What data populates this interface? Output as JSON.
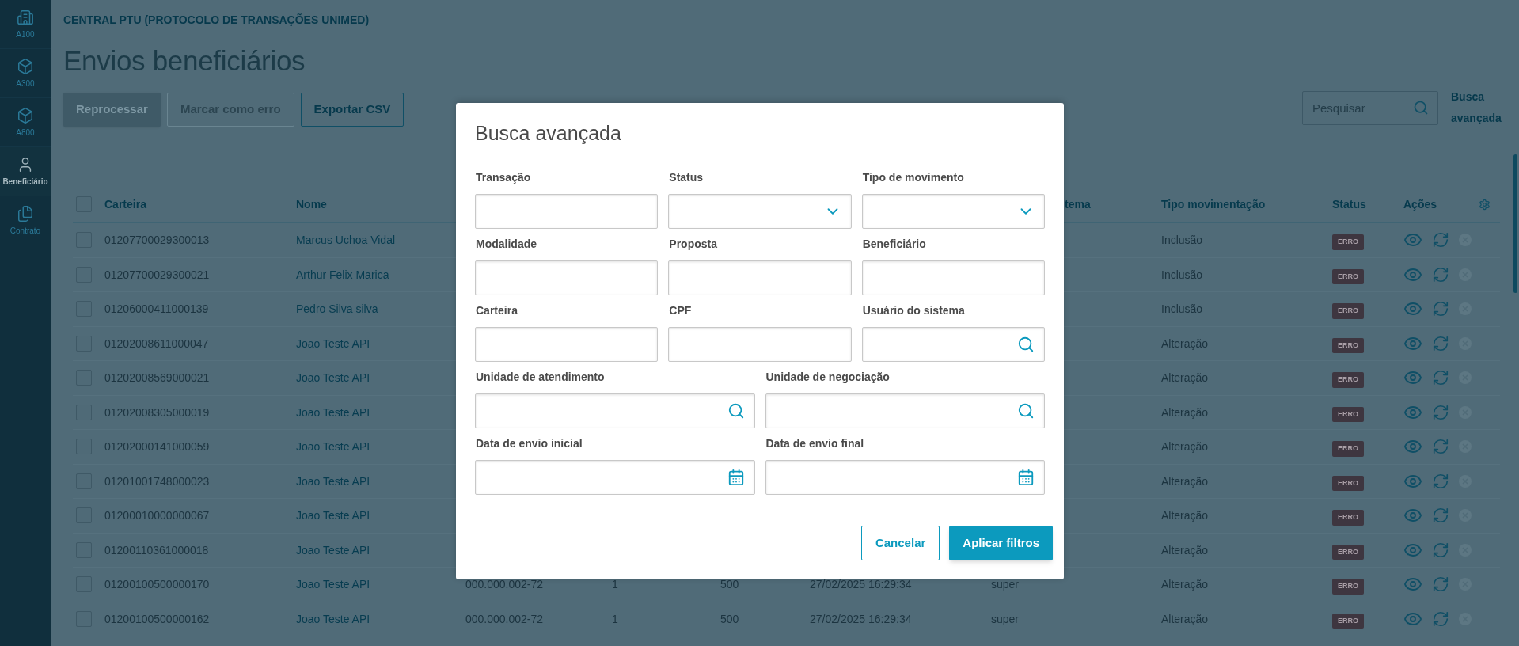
{
  "sidebar": {
    "items": [
      {
        "label": "A100",
        "selected": false
      },
      {
        "label": "A300",
        "selected": false
      },
      {
        "label": "A800",
        "selected": false
      },
      {
        "label": "Beneficiário",
        "selected": true
      },
      {
        "label": "Contrato",
        "selected": false
      }
    ]
  },
  "breadcrumb": "CENTRAL PTU (PROTOCOLO DE TRANSAÇÕES UNIMED)",
  "title": "Envios beneficiários",
  "actions": [
    {
      "label": "Reprocessar",
      "kind": "primary",
      "disabled": true
    },
    {
      "label": "Marcar como erro",
      "kind": "outline",
      "disabled": true
    },
    {
      "label": "Exportar CSV",
      "kind": "outline",
      "disabled": false
    }
  ],
  "search": {
    "placeholder": "Pesquisar"
  },
  "advanced_link": "Busca avançada",
  "table": {
    "select_all_checked": false,
    "header": [
      "Carteira",
      "Nome",
      "tema",
      "Tipo movimentação",
      "Status",
      "Ações"
    ],
    "rows": [
      {
        "checked": false,
        "carteira": "01207700029300013",
        "nome": "Marcus Uchoa Vidal",
        "tipo": "Inclusão",
        "status": "ERRO"
      },
      {
        "checked": false,
        "carteira": "01207700029300021",
        "nome": "Arthur Felix Marica",
        "tipo": "Inclusão",
        "status": "ERRO"
      },
      {
        "checked": false,
        "carteira": "01206000411000139",
        "nome": "Pedro Silva silva",
        "tipo": "Inclusão",
        "status": "ERRO"
      },
      {
        "checked": false,
        "carteira": "01202008611000047",
        "nome": "Joao Teste API",
        "tipo": "Alteração",
        "status": "ERRO"
      },
      {
        "checked": false,
        "carteira": "01202008569000021",
        "nome": "Joao Teste API",
        "tipo": "Alteração",
        "status": "ERRO"
      },
      {
        "checked": false,
        "carteira": "01202008305000019",
        "nome": "Joao Teste API",
        "tipo": "Alteração",
        "status": "ERRO"
      },
      {
        "checked": false,
        "carteira": "01202000141000059",
        "nome": "Joao Teste API",
        "tipo": "Alteração",
        "status": "ERRO"
      },
      {
        "checked": false,
        "carteira": "01201001748000023",
        "nome": "Joao Teste API",
        "tipo": "Alteração",
        "status": "ERRO"
      },
      {
        "checked": false,
        "carteira": "01200010000000067",
        "nome": "Joao Teste API",
        "tipo": "Alteração",
        "status": "ERRO"
      },
      {
        "checked": false,
        "carteira": "01200110361000018",
        "nome": "Joao Teste API",
        "tipo": "Alteração",
        "status": "ERRO"
      },
      {
        "checked": false,
        "carteira": "01200100500000170",
        "nome": "Joao Teste API",
        "cpf": "000.000.002-72",
        "column_4": "1",
        "column_5": "500",
        "data": "27/02/2025 16:29:34",
        "usuario": "super",
        "tipo": "Alteração",
        "status": "ERRO"
      },
      {
        "checked": false,
        "carteira": "01200100500000162",
        "nome": "Joao Teste API",
        "cpf": "000.000.002-72",
        "column_4": "1",
        "column_5": "500",
        "data": "27/02/2025 16:29:34",
        "usuario": "super",
        "tipo": "Alteração",
        "status": "ERRO"
      }
    ]
  },
  "modal": {
    "title": "Busca avançada",
    "field_rows": [
      [
        {
          "label": "Transação",
          "kind": "text"
        },
        {
          "label": "Status",
          "kind": "select"
        },
        {
          "label": "Tipo de movimento",
          "kind": "select"
        }
      ],
      [
        {
          "label": "Modalidade",
          "kind": "text"
        },
        {
          "label": "Proposta",
          "kind": "text"
        },
        {
          "label": "Beneficiário",
          "kind": "text"
        }
      ],
      [
        {
          "label": "Carteira",
          "kind": "text"
        },
        {
          "label": "CPF",
          "kind": "text"
        },
        {
          "label": "Usuário do sistema",
          "kind": "search"
        }
      ],
      [
        {
          "label": "Unidade de atendimento",
          "kind": "search"
        },
        {
          "label": "Unidade de negociação",
          "kind": "search"
        }
      ],
      [
        {
          "label": "Data de envio inicial",
          "kind": "date"
        },
        {
          "label": "Data de envio final",
          "kind": "date"
        }
      ]
    ],
    "buttons": [
      {
        "label": "Cancelar",
        "kind": "secondary"
      },
      {
        "label": "Aplicar filtros",
        "kind": "primary"
      }
    ]
  }
}
